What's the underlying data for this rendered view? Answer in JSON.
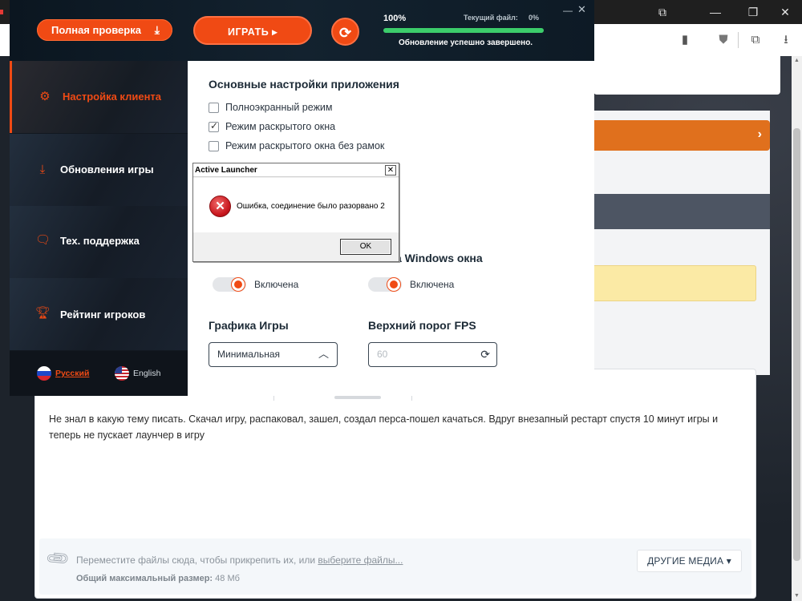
{
  "browser": {
    "window_controls": [
      "⧉",
      "—",
      "❐",
      "✕"
    ],
    "toolbar_icons": [
      "bookmark-icon",
      "shield-icon",
      "extensions-icon",
      "download-icon"
    ]
  },
  "launcher": {
    "buttons": {
      "full_check": "Полная проверка",
      "play": "ИГРАТЬ ▸"
    },
    "progress": {
      "percent_label": "100%",
      "percent": 100,
      "current_file_label": "Текущий файл:",
      "current_file_value": "0%",
      "status": "Обновление успешно завершено."
    },
    "sidebar": {
      "items": [
        {
          "label": "Настройка клиента",
          "icon": "gear-icon",
          "active": true
        },
        {
          "label": "Обновления игры",
          "icon": "download-icon",
          "active": false
        },
        {
          "label": "Тех. поддержка",
          "icon": "support-icon",
          "active": false
        },
        {
          "label": "Рейтинг игроков",
          "icon": "trophy-icon",
          "active": false
        }
      ],
      "languages": [
        {
          "label": "Русский",
          "active": true
        },
        {
          "label": "English",
          "active": false
        }
      ]
    },
    "settings": {
      "main_heading": "Основные настройки приложения",
      "display_modes": [
        {
          "label": "Полноэкранный режим",
          "checked": false
        },
        {
          "label": "Режим раскрытого окна",
          "checked": true
        },
        {
          "label": "Режим раскрытого окна без рамок",
          "checked": false
        }
      ],
      "windows_heading_partial": "а Windows окна",
      "toggles": [
        {
          "label": "Включена",
          "on": true
        },
        {
          "label": "Включена",
          "on": true
        }
      ],
      "graphics_heading": "Графика Игры",
      "graphics_value": "Минимальная",
      "fps_heading": "Верхний порог FPS",
      "fps_value": "60"
    }
  },
  "dialog": {
    "title": "Active Launcher",
    "message": "Ошибка, соединение было разорвано 2",
    "ok_label": "OK"
  },
  "forum": {
    "post_text": "Не знал в какую тему писать. Скачал игру, распаковал, зашел, создал перса-пошел качаться. Вдруг внезапный рестарт спустя 10 минут игры и теперь не пускает лаунчер в игру",
    "attach_text": "Переместите файлы сюда, чтобы прикрепить их, или ",
    "attach_link": "выберите файлы...",
    "max_size_label": "Общий максимальный размер:",
    "max_size_value": "48 Мб",
    "media_button": "ДРУГИЕ МЕДИА ▾"
  }
}
